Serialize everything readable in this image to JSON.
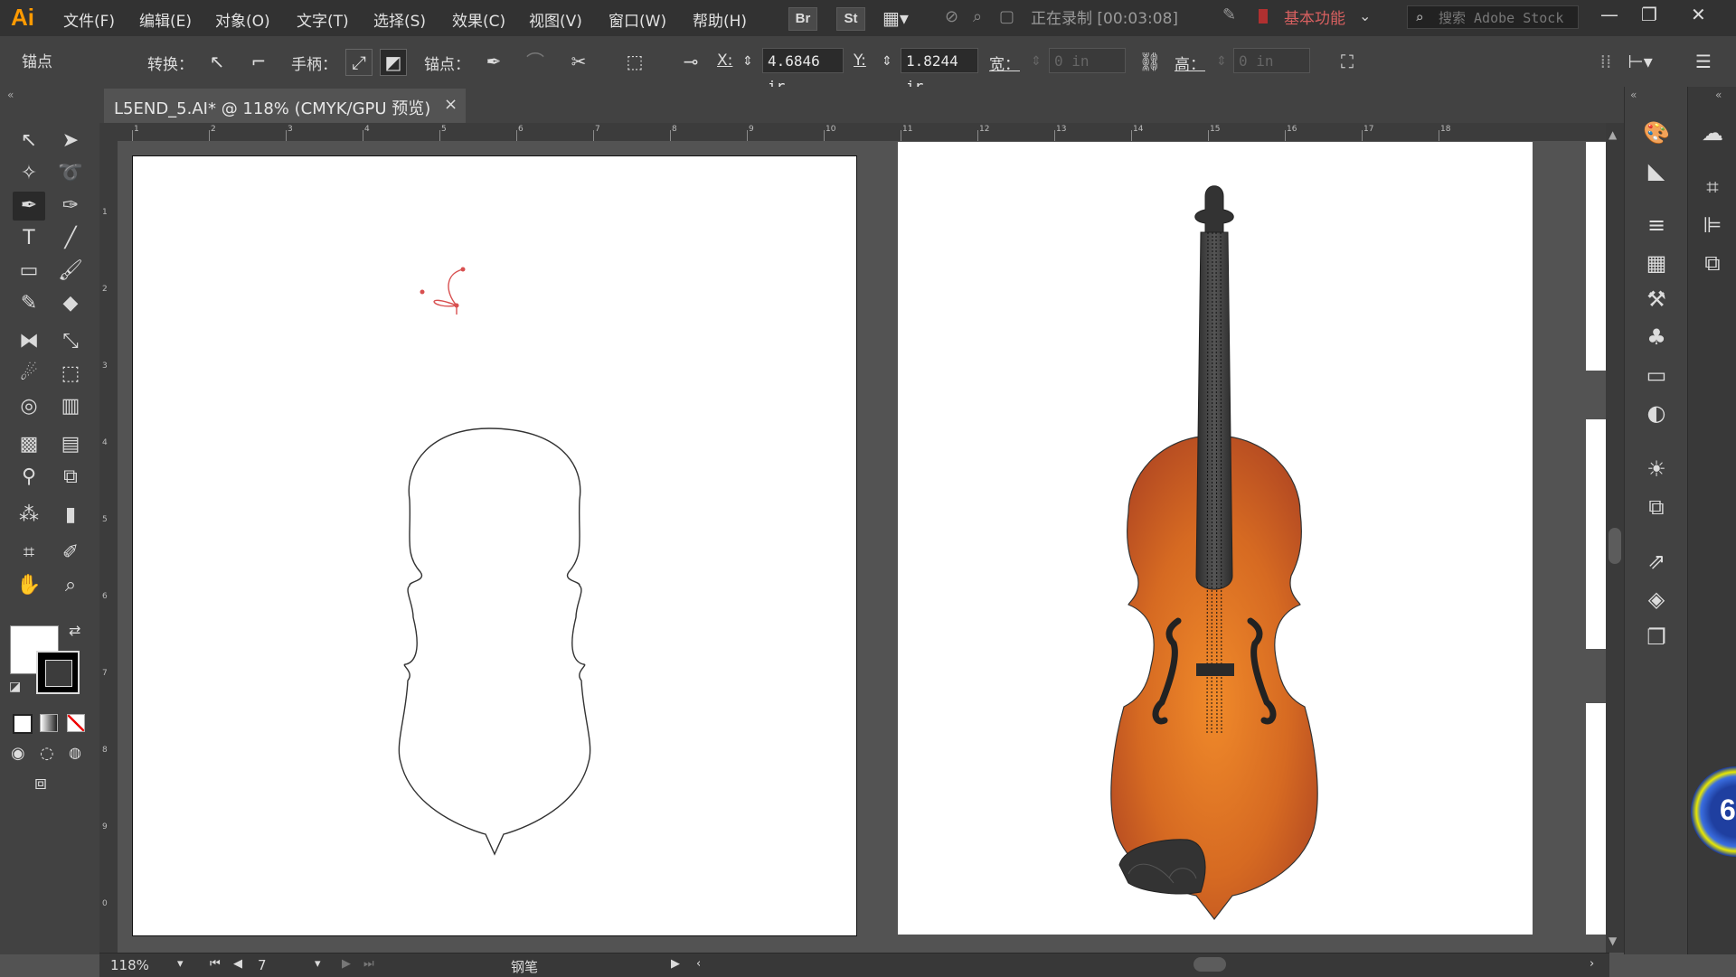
{
  "app": {
    "logo": "Ai"
  },
  "menu": [
    "文件(F)",
    "编辑(E)",
    "对象(O)",
    "文字(T)",
    "选择(S)",
    "效果(C)",
    "视图(V)",
    "窗口(W)",
    "帮助(H)"
  ],
  "bridge_buttons": {
    "br": "Br",
    "st": "St"
  },
  "recording": "正在录制 [00:03:08]",
  "workspace": "基本功能",
  "search": {
    "placeholder": "搜索 Adobe Stock"
  },
  "control": {
    "anchor_label": "锚点",
    "convert_label": "转换：",
    "handles_label": "手柄：",
    "anchors_label": "锚点：",
    "x_label": "X:",
    "x_value": "4.6846 ir",
    "y_label": "Y:",
    "y_value": "1.8244 ir",
    "w_label": "宽：",
    "w_value": "0 in",
    "h_label": "高：",
    "h_value": "0 in"
  },
  "document": {
    "tab_title": "L5END_5.AI* @ 118% (CMYK/GPU 预览)",
    "close": "×"
  },
  "ruler_top": [
    "1",
    "2",
    "3",
    "4",
    "5",
    "6",
    "7",
    "8",
    "9",
    "10",
    "11",
    "12",
    "13",
    "14",
    "15",
    "16",
    "17",
    "18"
  ],
  "ruler_left": [
    "1",
    "2",
    "3",
    "4",
    "5",
    "6",
    "7",
    "8",
    "9",
    "0"
  ],
  "status": {
    "zoom": "118%",
    "artboard": "7",
    "tool_name": "钢笔"
  },
  "badge": {
    "number": "6"
  },
  "colors": {
    "accent": "#ff9a00",
    "ui_dark": "#323232",
    "panel": "#424242",
    "canvas": "#535353",
    "violin_orange": "#e8782a",
    "violin_dark": "#3a3a3a"
  }
}
